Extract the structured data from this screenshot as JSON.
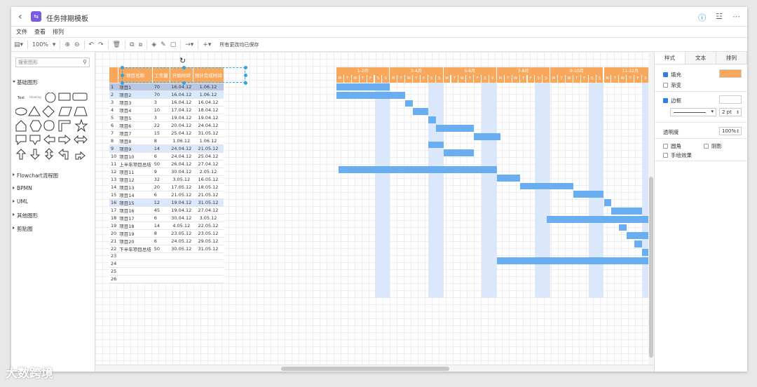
{
  "window": {
    "title": "任务排期模板",
    "logo_text": "⇆",
    "right_icons": [
      "info-icon",
      "share-icon",
      "more-icon"
    ]
  },
  "menu": [
    "文件",
    "查看",
    "排列"
  ],
  "toolbar": {
    "zoom": "100%",
    "status": "所有更改均已保存"
  },
  "left_panel": {
    "search_placeholder": "搜索图形",
    "sections": [
      "基础图形",
      "Flowchart流程图",
      "BPMN",
      "UML",
      "其他图形",
      "剪贴图"
    ],
    "shape_text_labels": [
      "Text",
      "Heading"
    ]
  },
  "right_panel": {
    "tabs": [
      "样式",
      "文本",
      "排列"
    ],
    "fill_label": "填充",
    "fill_color": "#f8a85c",
    "gradient_label": "渐变",
    "line_label": "边框",
    "line_width": "2 pt",
    "opacity_label": "透明度",
    "opacity_value": "100%",
    "rounded_label": "圆角",
    "shadow_label": "阴影",
    "sketch_label": "手绘效果"
  },
  "gantt": {
    "headers": [
      "项目名称",
      "工作量",
      "开始时间",
      "预计完成时间"
    ],
    "months": [
      "1-2月",
      "3-4月",
      "5-6月",
      "7-8月",
      "9-10月",
      "11-12月"
    ],
    "day_letters": [
      "M",
      "T",
      "W",
      "T",
      "F",
      "S",
      "S"
    ],
    "rows": [
      {
        "n": "1",
        "name": "项目1",
        "w": "70",
        "s": "16.04.12",
        "e": "1.06.12",
        "bs": 0,
        "bl": 7
      },
      {
        "n": "2",
        "name": "项目2",
        "w": "70",
        "s": "16.04.12",
        "e": "1.06.12",
        "bs": 0,
        "bl": 9
      },
      {
        "n": "3",
        "name": "项目3",
        "w": "3",
        "s": "16.04.12",
        "e": "16.04.12",
        "bs": 9,
        "bl": 1
      },
      {
        "n": "4",
        "name": "项目4",
        "w": "10",
        "s": "17.04.12",
        "e": "18.04.12",
        "bs": 10,
        "bl": 2
      },
      {
        "n": "5",
        "name": "项目5",
        "w": "3",
        "s": "19.04.12",
        "e": "19.04.12",
        "bs": 12,
        "bl": 1
      },
      {
        "n": "6",
        "name": "项目6",
        "w": "22",
        "s": "20.04.12",
        "e": "24.04.12",
        "bs": 13,
        "bl": 5
      },
      {
        "n": "7",
        "name": "项目7",
        "w": "15",
        "s": "25.04.12",
        "e": "31.05.12",
        "bs": 18,
        "bl": 3.5
      },
      {
        "n": "8",
        "name": "项目8",
        "w": "8",
        "s": "1.06.12",
        "e": "1.06.12",
        "bs": 12,
        "bl": 2
      },
      {
        "n": "9",
        "name": "项目9",
        "w": "14",
        "s": "24.04.12",
        "e": "21.05.12",
        "bs": 14,
        "bl": 4
      },
      {
        "n": "10",
        "name": "项目10",
        "w": "6",
        "s": "24.04.12",
        "e": "25.04.12",
        "bs": 0,
        "bl": 0
      },
      {
        "n": "11",
        "name": "上半年项目总结",
        "w": "50",
        "s": "26.04.12",
        "e": "27.04.12",
        "bs": 0.3,
        "bl": 20.7
      },
      {
        "n": "12",
        "name": "项目11",
        "w": "9",
        "s": "30.04.12",
        "e": "2.05.12",
        "bs": 21,
        "bl": 3
      },
      {
        "n": "13",
        "name": "项目12",
        "w": "32",
        "s": "3.05.12",
        "e": "16.05.12",
        "bs": 24,
        "bl": 7
      },
      {
        "n": "14",
        "name": "项目13",
        "w": "20",
        "s": "17.05.12",
        "e": "18.05.12",
        "bs": 31,
        "bl": 4
      },
      {
        "n": "15",
        "name": "项目14",
        "w": "6",
        "s": "21.05.12",
        "e": "21.05.12",
        "bs": 35,
        "bl": 1
      },
      {
        "n": "16",
        "name": "项目15",
        "w": "12",
        "s": "19.04.12",
        "e": "31.05.12",
        "bs": 36,
        "bl": 4
      },
      {
        "n": "17",
        "name": "项目16",
        "w": "45",
        "s": "19.04.12",
        "e": "27.04.12",
        "bs": 27.5,
        "bl": 13.5
      },
      {
        "n": "18",
        "name": "项目17",
        "w": "6",
        "s": "30.04.12",
        "e": "3.05.12",
        "bs": 37,
        "bl": 1
      },
      {
        "n": "19",
        "name": "项目18",
        "w": "14",
        "s": "4.05.12",
        "e": "22.05.12",
        "bs": 38,
        "bl": 4
      },
      {
        "n": "20",
        "name": "项目19",
        "w": "8",
        "s": "23.05.12",
        "e": "23.05.12",
        "bs": 39,
        "bl": 1
      },
      {
        "n": "21",
        "name": "项目20",
        "w": "6",
        "s": "24.05.12",
        "e": "29.05.12",
        "bs": 40,
        "bl": 2
      },
      {
        "n": "22",
        "name": "下半年项目总结",
        "w": "50",
        "s": "30.05.12",
        "e": "31.05.12",
        "bs": 21,
        "bl": 21
      },
      {
        "n": "23",
        "name": "",
        "w": "",
        "s": "",
        "e": "",
        "bs": 0,
        "bl": 0
      },
      {
        "n": "24",
        "name": "",
        "w": "",
        "s": "",
        "e": "",
        "bs": 0,
        "bl": 0
      },
      {
        "n": "25",
        "name": "",
        "w": "",
        "s": "",
        "e": "",
        "bs": 0,
        "bl": 0
      },
      {
        "n": "26",
        "name": "",
        "w": "",
        "s": "",
        "e": "",
        "bs": 0,
        "bl": 0
      }
    ]
  },
  "watermark": "大数跨境"
}
